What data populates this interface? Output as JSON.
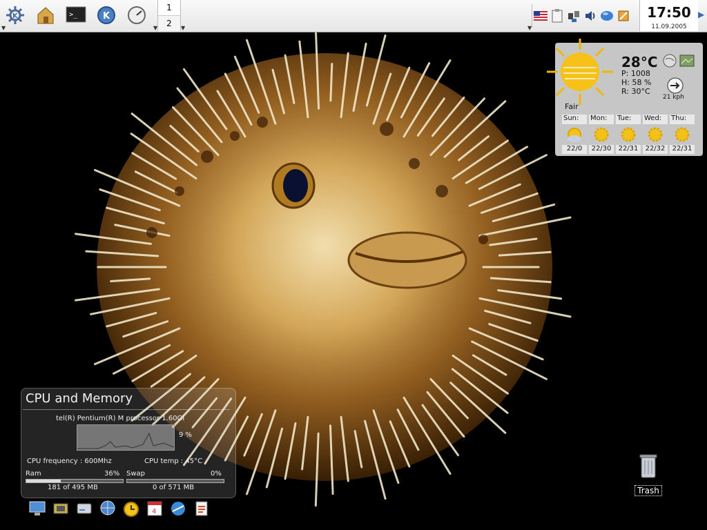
{
  "panel": {
    "launchers": [
      {
        "icon": "kde-menu-icon"
      },
      {
        "icon": "home-folder-icon"
      },
      {
        "icon": "terminal-icon"
      },
      {
        "icon": "konqueror-icon"
      },
      {
        "icon": "system-monitor-icon"
      }
    ],
    "pager": {
      "desktops": [
        "1",
        "2"
      ],
      "active": "1"
    },
    "tray_icons": [
      "us-flag-icon",
      "clipboard-icon",
      "network-icon",
      "volume-icon",
      "globe-icon",
      "updater-icon"
    ],
    "clock": {
      "time": "17:50",
      "date": "11.09.2005"
    }
  },
  "weather": {
    "temperature": "28°C",
    "pressure": "P: 1008",
    "humidity": "H: 58 %",
    "realfeel": "R: 30°C",
    "condition": "Fair",
    "wind": "21 kph",
    "forecast": [
      {
        "day": "Sun:",
        "temps": "22/0",
        "icon": "cloudy-sun-icon"
      },
      {
        "day": "Mon:",
        "temps": "22/30",
        "icon": "sun-icon"
      },
      {
        "day": "Tue:",
        "temps": "22/31",
        "icon": "sun-icon"
      },
      {
        "day": "Wed:",
        "temps": "22/32",
        "icon": "sun-icon"
      },
      {
        "day": "Thu:",
        "temps": "22/31",
        "icon": "sun-icon"
      }
    ]
  },
  "cpu_widget": {
    "title": "CPU and Memory",
    "processor": "tel(R) Pentium(R) M processor 1.60GI",
    "cpu_percent": "9 %",
    "frequency": "CPU frequency : 600Mhz",
    "temp": "CPU temp : 45°C",
    "ram_label": "Ram",
    "ram_percent": "36%",
    "ram_usage": "181 of 495 MB",
    "ram_fraction": 0.36,
    "swap_label": "Swap",
    "swap_percent": "0%",
    "swap_usage": "0 of 571 MB",
    "swap_fraction": 0.0
  },
  "dock": [
    "monitor-icon",
    "hardware-icon",
    "drive-icon",
    "network-globe-icon",
    "alarm-clock-icon",
    "calendar-icon",
    "browser-icon",
    "office-icon"
  ],
  "desktop": {
    "trash_label": "Trash"
  }
}
